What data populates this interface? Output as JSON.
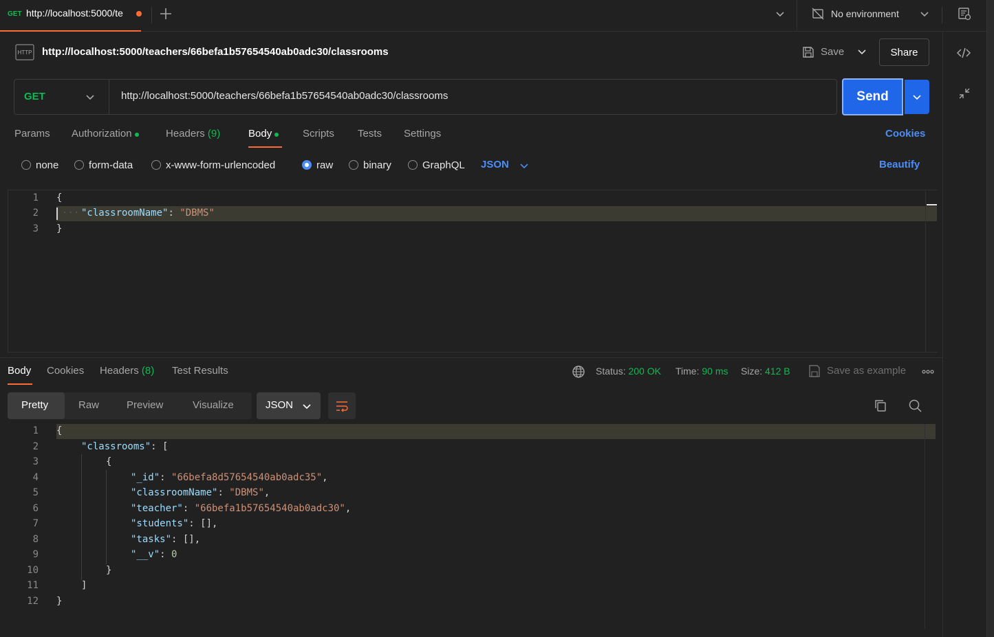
{
  "tab": {
    "method": "GET",
    "title": "http://localhost:5000/te"
  },
  "environment": {
    "label": "No environment"
  },
  "request": {
    "title": "http://localhost:5000/teachers/66befa1b57654540ab0adc30/classrooms",
    "save_label": "Save",
    "share_label": "Share",
    "method": "GET",
    "url": "http://localhost:5000/teachers/66befa1b57654540ab0adc30/classrooms",
    "send_label": "Send"
  },
  "request_tabs": {
    "params": "Params",
    "authorization": "Authorization",
    "headers": "Headers",
    "headers_count": "(9)",
    "body": "Body",
    "scripts": "Scripts",
    "tests": "Tests",
    "settings": "Settings",
    "cookies": "Cookies"
  },
  "body_modes": {
    "none": "none",
    "form_data": "form-data",
    "urlencoded": "x-www-form-urlencoded",
    "raw": "raw",
    "binary": "binary",
    "graphql": "GraphQL",
    "selected": "raw",
    "language": "JSON",
    "beautify": "Beautify"
  },
  "request_body": {
    "line_numbers": [
      "1",
      "2",
      "3"
    ],
    "lines": [
      {
        "open": "{"
      },
      {
        "key": "\"classroomName\"",
        "sep": ": ",
        "value": "\"DBMS\""
      },
      {
        "close": "}"
      }
    ]
  },
  "response_tabs": {
    "body": "Body",
    "cookies": "Cookies",
    "headers": "Headers",
    "headers_count": "(8)",
    "test_results": "Test Results"
  },
  "response_status": {
    "status_label": "Status:",
    "status_value": "200 OK",
    "time_label": "Time:",
    "time_value": "90 ms",
    "size_label": "Size:",
    "size_value": "412 B",
    "save_as_example": "Save as example",
    "status_color": "#0cbb52"
  },
  "view_modes": {
    "pretty": "Pretty",
    "raw": "Raw",
    "preview": "Preview",
    "visualize": "Visualize",
    "format": "JSON"
  },
  "response_body": {
    "line_numbers": [
      "1",
      "2",
      "3",
      "4",
      "5",
      "6",
      "7",
      "8",
      "9",
      "10",
      "11",
      "12"
    ],
    "l1": "{",
    "l2_key": "\"classrooms\"",
    "l2_rest": ": [",
    "l3": "{",
    "l4_key": "\"_id\"",
    "l4_val": "\"66befa8d57654540ab0adc35\"",
    "l5_key": "\"classroomName\"",
    "l5_val": "\"DBMS\"",
    "l6_key": "\"teacher\"",
    "l6_val": "\"66befa1b57654540ab0adc30\"",
    "l7_key": "\"students\"",
    "l7_val": "[]",
    "l8_key": "\"tasks\"",
    "l8_val": "[]",
    "l9_key": "\"__v\"",
    "l9_val": "0",
    "l10": "}",
    "l11": "]",
    "l12": "}",
    "colon": ": ",
    "comma": ","
  },
  "colors": {
    "accent": "#ff6c37",
    "primary": "#1f66e8",
    "link": "#4c8df6",
    "method_get": "#0cbb52"
  }
}
